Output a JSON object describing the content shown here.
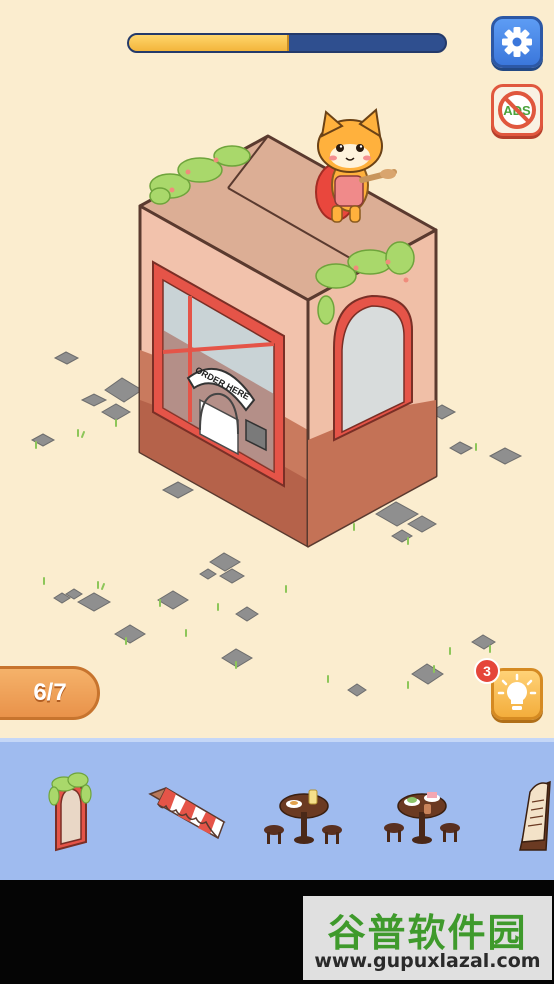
{
  "hud": {
    "progress_fraction": 0.5,
    "settings_icon": "gear-icon",
    "noads_icon": "no-ads-icon",
    "noads_label": "ADS"
  },
  "building": {
    "sign_text": "ORDER HERE"
  },
  "level": {
    "counter": "6/7"
  },
  "hint": {
    "count": "3",
    "icon": "lightbulb-icon"
  },
  "tray": {
    "items": [
      {
        "name": "ivy-arch-window",
        "icon": "arch-window-icon"
      },
      {
        "name": "striped-awning",
        "icon": "awning-icon"
      },
      {
        "name": "cafe-table-drink",
        "icon": "table-icon"
      },
      {
        "name": "cafe-table-cake",
        "icon": "table-icon"
      },
      {
        "name": "menu-board",
        "icon": "menu-board-icon"
      }
    ]
  },
  "watermark": {
    "title": "谷普软件园",
    "url": "www.gupuxlazal.com"
  },
  "colors": {
    "background": "#fbedcf",
    "tray": "#9fbbef",
    "progress_fill": "#f3b53b",
    "progress_track": "#2f4f8f",
    "accent_orange": "#e9924a",
    "badge_red": "#e5463a"
  }
}
